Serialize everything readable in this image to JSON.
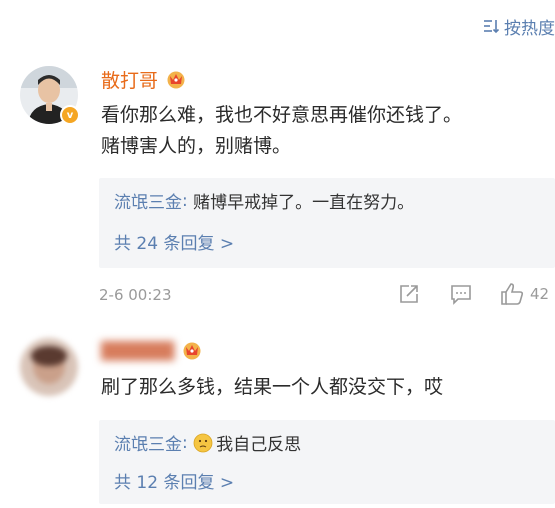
{
  "sort": {
    "label": "按热度",
    "icon": "sort-icon"
  },
  "comments": [
    {
      "username": "散打哥",
      "badge": "crown-vip-icon",
      "text_lines": [
        "看你那么难，我也不好意思再催你还钱了。",
        "赌博害人的，别赌博。"
      ],
      "reply": {
        "author": "流氓三金",
        "text": "赌博早戒掉了。一直在努力。"
      },
      "more_replies": "共 24 条回复 >",
      "timestamp": "2-6 00:23",
      "likes": "42"
    },
    {
      "username": "▇▇▇▇▇",
      "badge": "crown-vip-icon",
      "text_lines": [
        "刷了那么多钱，结果一个人都没交下，哎"
      ],
      "reply": {
        "author": "流氓三金",
        "emoji": "thinking-face-icon",
        "text": "我自己反思"
      },
      "more_replies": "共 12 条回复 >"
    }
  ],
  "colors": {
    "link": "#5b7fb0",
    "username": "#e86b1a",
    "gray": "#9a9a9a",
    "reply_bg": "#f4f5f7"
  }
}
